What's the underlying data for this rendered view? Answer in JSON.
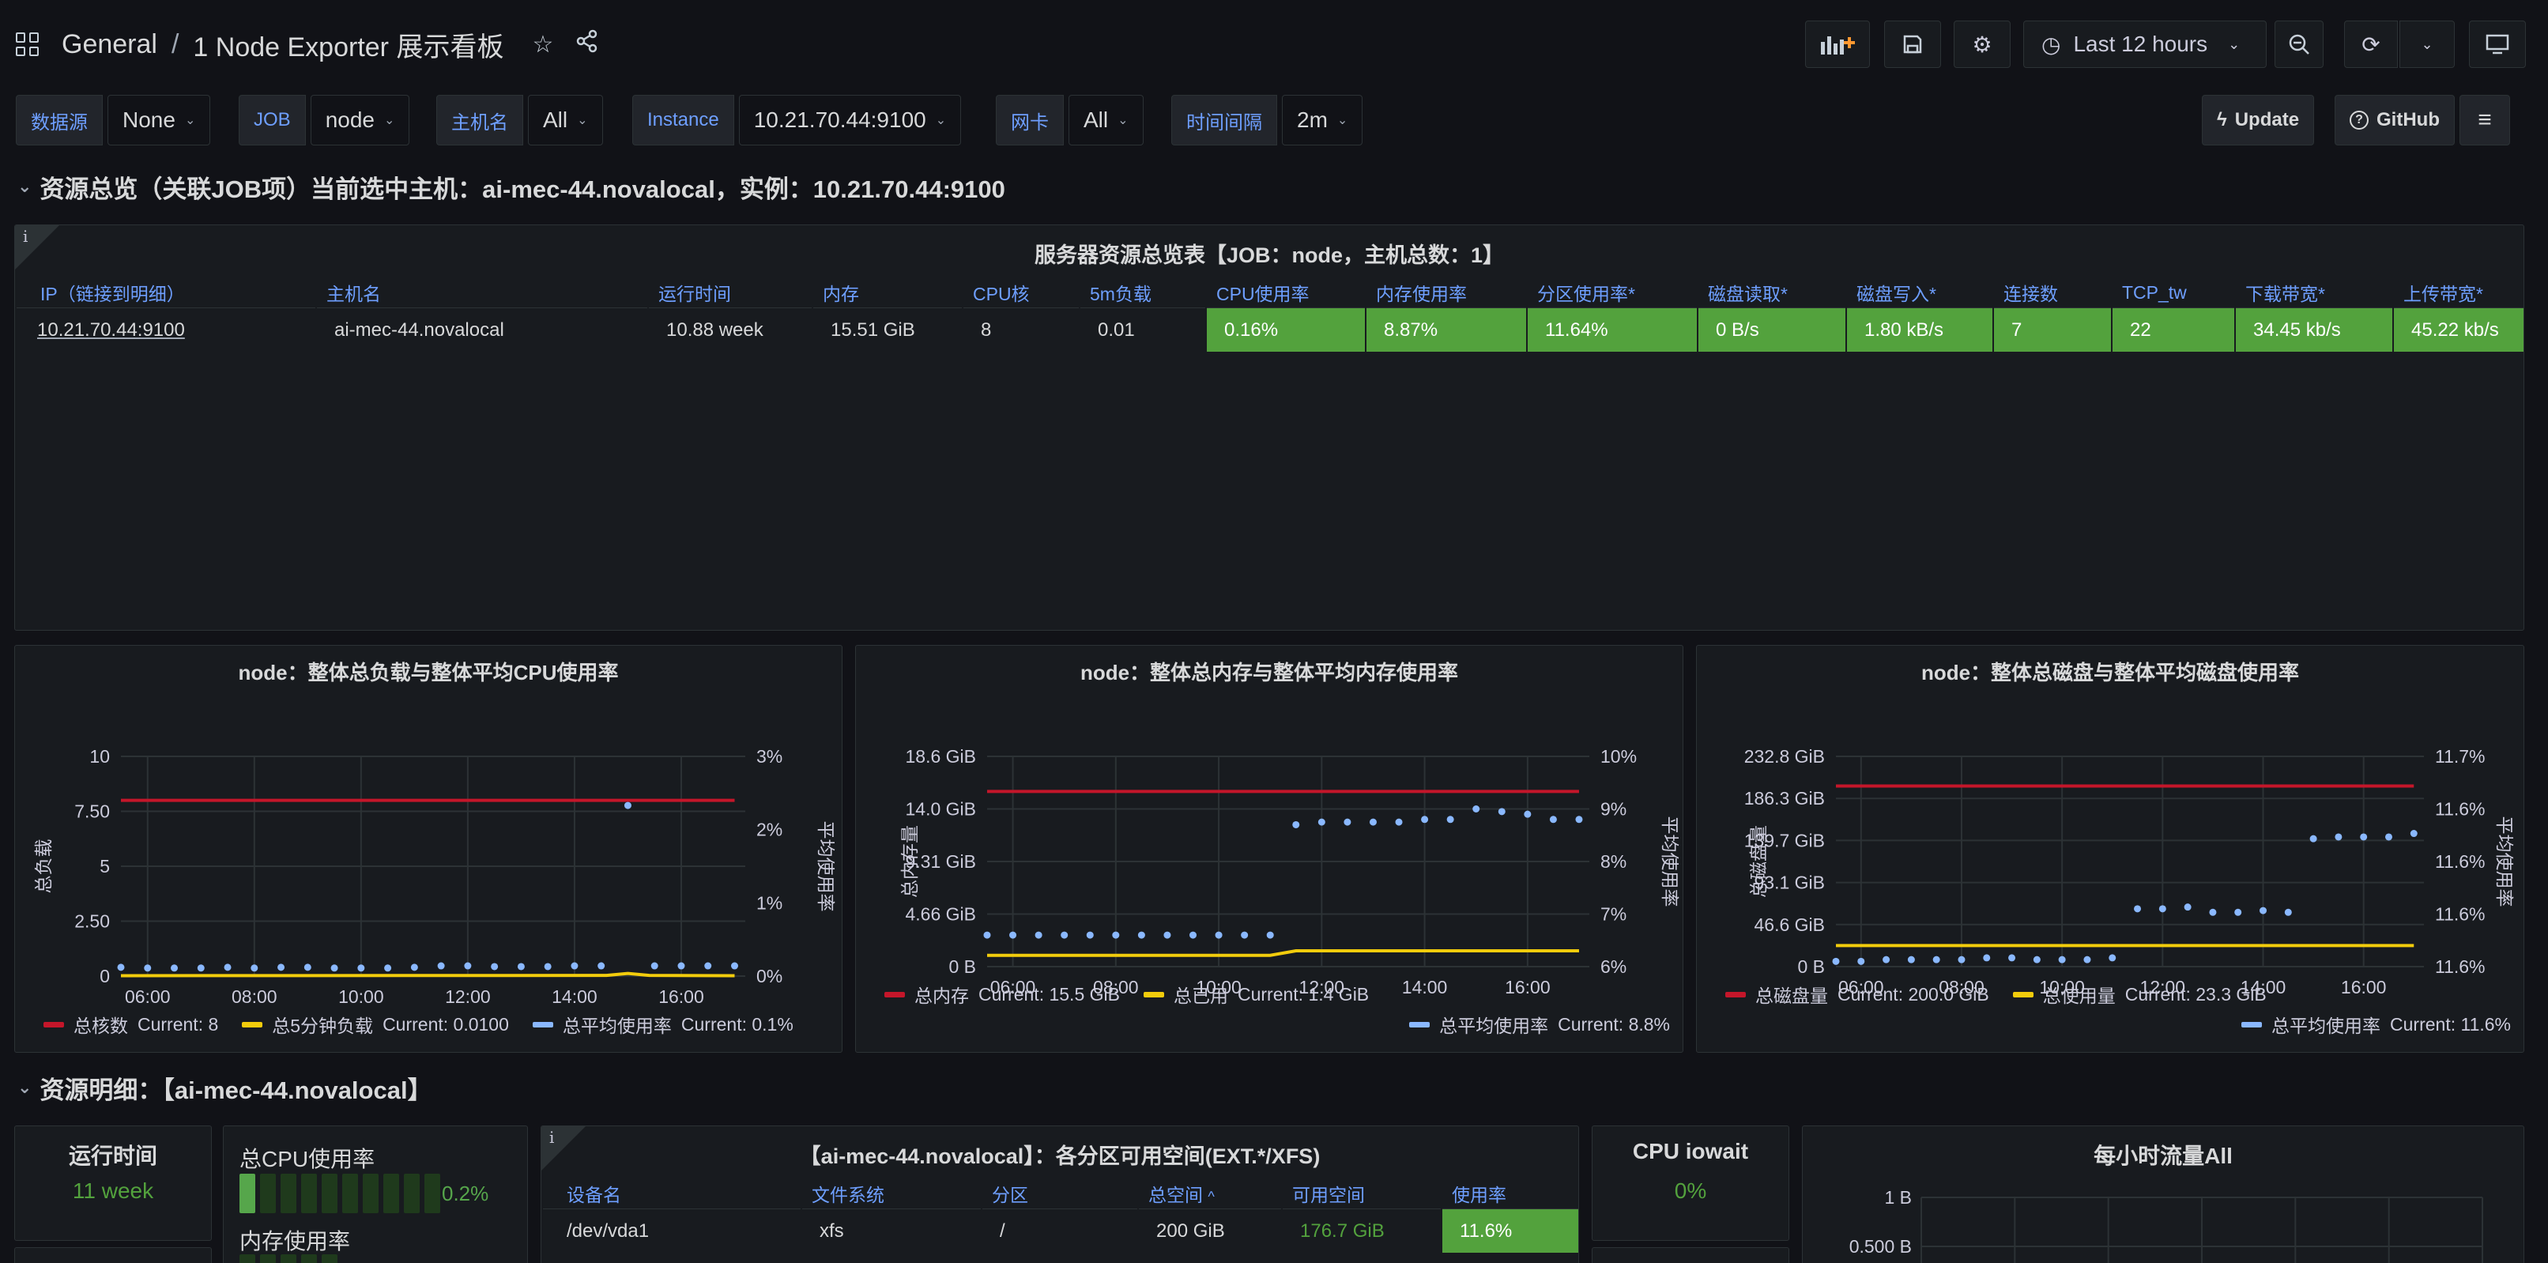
{
  "header": {
    "crumb_folder": "General",
    "crumb_sep": "/",
    "dashboard_title": "1 Node Exporter 展示看板",
    "time_range": "Last 12 hours"
  },
  "variables": [
    {
      "label": "数据源",
      "value": "None"
    },
    {
      "label": "JOB",
      "value": "node"
    },
    {
      "label": "主机名",
      "value": "All"
    },
    {
      "label": "Instance",
      "value": "10.21.70.44:9100"
    },
    {
      "label": "网卡",
      "value": "All"
    },
    {
      "label": "时间间隔",
      "value": "2m"
    }
  ],
  "links": {
    "update": "Update",
    "github": "GitHub"
  },
  "row1": {
    "title": "资源总览（关联JOB项）当前选中主机：ai-mec-44.novalocal，实例：10.21.70.44:9100"
  },
  "overview": {
    "title": "服务器资源总览表【JOB：node，主机总数：1】",
    "columns": [
      "IP（链接到明细）",
      "主机名",
      "运行时间",
      "内存",
      "CPU核",
      "5m负载",
      "CPU使用率",
      "内存使用率",
      "分区使用率*",
      "磁盘读取*",
      "磁盘写入*",
      "连接数",
      "TCP_tw",
      "下载带宽*",
      "上传带宽*"
    ],
    "rows": [
      [
        "10.21.70.44:9100",
        "ai-mec-44.novalocal",
        "10.88 week",
        "15.51 GiB",
        "8",
        "0.01",
        "0.16%",
        "8.87%",
        "11.64%",
        "0 B/s",
        "1.80 kB/s",
        "7",
        "22",
        "34.45 kb/s",
        "45.22 kb/s"
      ]
    ]
  },
  "colors": {
    "red": "#c4162a",
    "yellow": "#f2cc0c",
    "cyan": "#8ab8ff",
    "green": "#53a23d",
    "blue_text": "#6e9fff"
  },
  "chart_data": [
    {
      "type": "line",
      "title": "node：整体总负载与整体平均CPU使用率",
      "ylabel": "总负载",
      "ylabel_right": "平均使用率",
      "x_ticks": [
        "06:00",
        "08:00",
        "10:00",
        "12:00",
        "14:00",
        "16:00"
      ],
      "y_ticks": [
        "0",
        "2.50",
        "5",
        "7.50",
        "10"
      ],
      "y_ticks_right": [
        "0%",
        "1%",
        "2%",
        "3%"
      ],
      "ylim": [
        0,
        10
      ],
      "ylim_right": [
        0,
        3
      ],
      "x_range": [
        5.5,
        17.2
      ],
      "series": [
        {
          "name": "总核数",
          "axis": "left",
          "style": "line",
          "color": "#c4162a",
          "current": "Current: 8",
          "x": [
            5.5,
            17.0
          ],
          "y": [
            8,
            8
          ]
        },
        {
          "name": "总5分钟负载",
          "axis": "left",
          "style": "line",
          "color": "#f2cc0c",
          "current": "Current: 0.0100",
          "x": [
            5.5,
            14.6,
            15.0,
            15.4,
            17.0
          ],
          "y": [
            0.02,
            0.03,
            0.12,
            0.03,
            0.02
          ]
        },
        {
          "name": "总平均使用率",
          "axis": "right",
          "style": "points",
          "color": "#8ab8ff",
          "current": "Current: 0.1%",
          "x": [
            5.5,
            6.0,
            6.5,
            7.0,
            7.5,
            8.0,
            8.5,
            9.0,
            9.5,
            10.0,
            10.5,
            11.0,
            11.5,
            12.0,
            12.5,
            13.0,
            13.5,
            14.0,
            14.5,
            15.0,
            15.5,
            16.0,
            16.5,
            17.0
          ],
          "y": [
            0.12,
            0.11,
            0.11,
            0.11,
            0.12,
            0.11,
            0.12,
            0.12,
            0.11,
            0.11,
            0.11,
            0.12,
            0.14,
            0.14,
            0.13,
            0.13,
            0.13,
            0.14,
            0.14,
            2.33,
            0.14,
            0.14,
            0.14,
            0.14
          ]
        }
      ]
    },
    {
      "type": "line",
      "title": "node：整体总内存与整体平均内存使用率",
      "ylabel": "总内存量",
      "ylabel_right": "平均使用率",
      "x_ticks": [
        "06:00",
        "08:00",
        "10:00",
        "12:00",
        "14:00",
        "16:00"
      ],
      "y_ticks": [
        "0 B",
        "4.66 GiB",
        "9.31 GiB",
        "14.0 GiB",
        "18.6 GiB"
      ],
      "y_ticks_right": [
        "6%",
        "7%",
        "8%",
        "9%",
        "10%"
      ],
      "ylim": [
        0,
        18.6
      ],
      "ylim_right": [
        6,
        10
      ],
      "x_range": [
        5.5,
        17.2
      ],
      "series": [
        {
          "name": "总内存",
          "axis": "left",
          "style": "line",
          "color": "#c4162a",
          "current": "Current: 15.5 GiB",
          "x": [
            5.5,
            17.0
          ],
          "y": [
            15.5,
            15.5
          ]
        },
        {
          "name": "总已用",
          "axis": "left",
          "style": "line",
          "color": "#f2cc0c",
          "current": "Current: 1.4 GiB",
          "x": [
            5.5,
            11.0,
            11.5,
            17.0
          ],
          "y": [
            1.0,
            1.0,
            1.4,
            1.4
          ]
        },
        {
          "name": "总平均使用率",
          "axis": "right",
          "style": "points",
          "color": "#8ab8ff",
          "current": "Current: 8.8%",
          "x": [
            5.5,
            6.0,
            6.5,
            7.0,
            7.5,
            8.0,
            8.5,
            9.0,
            9.5,
            10.0,
            10.5,
            11.0,
            11.5,
            12.0,
            12.5,
            13.0,
            13.5,
            14.0,
            14.5,
            15.0,
            15.5,
            16.0,
            16.5,
            17.0
          ],
          "y": [
            6.6,
            6.6,
            6.6,
            6.6,
            6.6,
            6.6,
            6.6,
            6.6,
            6.6,
            6.6,
            6.6,
            6.6,
            8.7,
            8.75,
            8.75,
            8.75,
            8.75,
            8.8,
            8.8,
            9.0,
            8.95,
            8.9,
            8.8,
            8.8
          ]
        }
      ]
    },
    {
      "type": "line",
      "title": "node：整体总磁盘与整体平均磁盘使用率",
      "ylabel": "总磁盘量",
      "ylabel_right": "平均使用率",
      "x_ticks": [
        "06:00",
        "08:00",
        "10:00",
        "12:00",
        "14:00",
        "16:00"
      ],
      "y_ticks": [
        "0 B",
        "46.6 GiB",
        "93.1 GiB",
        "139.7 GiB",
        "186.3 GiB",
        "232.8 GiB"
      ],
      "y_ticks_right": [
        "11.6%",
        "11.6%",
        "11.6%",
        "11.6%",
        "11.7%"
      ],
      "ylim": [
        0,
        232.8
      ],
      "ylim_right": [
        11.56,
        11.68
      ],
      "x_range": [
        5.5,
        17.2
      ],
      "series": [
        {
          "name": "总磁盘量",
          "axis": "left",
          "style": "line",
          "color": "#c4162a",
          "current": "Current: 200.0 GiB",
          "x": [
            5.5,
            17.0
          ],
          "y": [
            200,
            200
          ]
        },
        {
          "name": "总使用量",
          "axis": "left",
          "style": "line",
          "color": "#f2cc0c",
          "current": "Current: 23.3 GiB",
          "x": [
            5.5,
            17.0
          ],
          "y": [
            23.3,
            23.3
          ]
        },
        {
          "name": "总平均使用率",
          "axis": "right",
          "style": "points",
          "color": "#8ab8ff",
          "current": "Current: 11.6%",
          "x": [
            5.5,
            6.0,
            6.5,
            7.0,
            7.5,
            8.0,
            8.5,
            9.0,
            9.5,
            10.0,
            10.5,
            11.0,
            11.5,
            12.0,
            12.5,
            13.0,
            13.5,
            14.0,
            14.5,
            15.0,
            15.5,
            16.0,
            16.5,
            17.0
          ],
          "y": [
            11.563,
            11.563,
            11.564,
            11.564,
            11.564,
            11.564,
            11.565,
            11.565,
            11.564,
            11.564,
            11.564,
            11.565,
            11.593,
            11.593,
            11.594,
            11.591,
            11.591,
            11.592,
            11.591,
            11.633,
            11.634,
            11.634,
            11.634,
            11.636
          ]
        }
      ]
    }
  ],
  "row2": {
    "title": "资源明细：【ai-mec-44.novalocal】"
  },
  "uptime": {
    "title": "运行时间",
    "value": "11 week"
  },
  "cpu_bars": {
    "cpu_label": "总CPU使用率",
    "cpu_value": "0.2%",
    "cpu_level": 0.2,
    "mem_label": "内存使用率"
  },
  "partitions": {
    "title": "【ai-mec-44.novalocal】：各分区可用空间(EXT.*/XFS)",
    "columns": [
      "设备名",
      "文件系统",
      "分区",
      "总空间",
      "可用空间",
      "使用率"
    ],
    "sort_icon": "^",
    "rows": [
      [
        "/dev/vda1",
        "xfs",
        "/",
        "200 GiB",
        "176.7 GiB",
        "11.6%"
      ]
    ]
  },
  "iowait": {
    "title": "CPU iowait",
    "value": "0%"
  },
  "traffic": {
    "title": "每小时流量All",
    "y_ticks": [
      "1 B",
      "0.500 B"
    ]
  }
}
